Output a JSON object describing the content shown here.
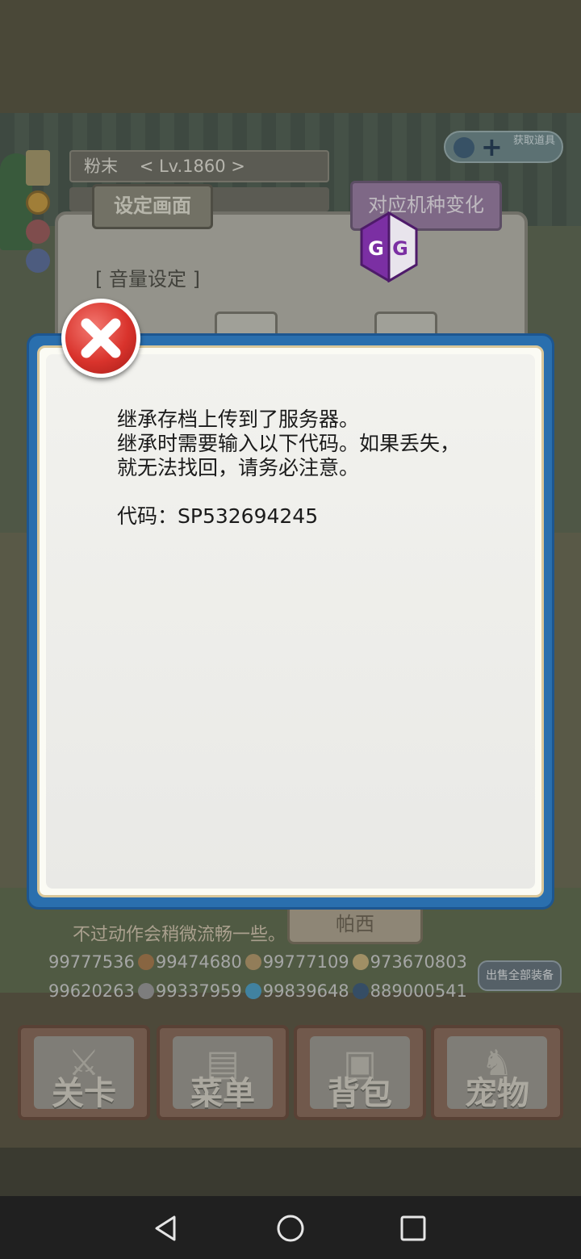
{
  "player": {
    "name_level": "粉末    < Lv.1860 >"
  },
  "get_item_button": {
    "label": "获取道具"
  },
  "settings": {
    "title": "设定画面",
    "device_button": "对应机种变化",
    "volume_label": "[ 音量设定 ]"
  },
  "overlay_app": {
    "icon": "gg-icon",
    "letters": "GG"
  },
  "dialog": {
    "message_line1": "继承存档上传到了服务器。",
    "message_line2": "继承时需要输入以下代码。如果丢失，",
    "message_line3": "就无法找回，请务必注意。",
    "code_line": "代码：SP532694245",
    "close_icon": "close-icon"
  },
  "behind_dialog": {
    "hint_text": "不过动作会稍微流畅一些。",
    "button_label": "帕西"
  },
  "resources": {
    "row1": [
      "99777536",
      "99474680",
      "99777109",
      "973670803"
    ],
    "row2": [
      "99620263",
      "99337959",
      "99839648",
      "889000541"
    ],
    "sell_all_label": "出售全部装备"
  },
  "bottom_menu": [
    {
      "label": "关卡",
      "icon": "crossed-swords-icon"
    },
    {
      "label": "菜单",
      "icon": "book-icon"
    },
    {
      "label": "背包",
      "icon": "backpack-icon"
    },
    {
      "label": "宠物",
      "icon": "dragon-icon"
    }
  ],
  "nav_bar": {
    "back": "back-icon",
    "home": "home-icon",
    "recents": "recents-icon"
  }
}
